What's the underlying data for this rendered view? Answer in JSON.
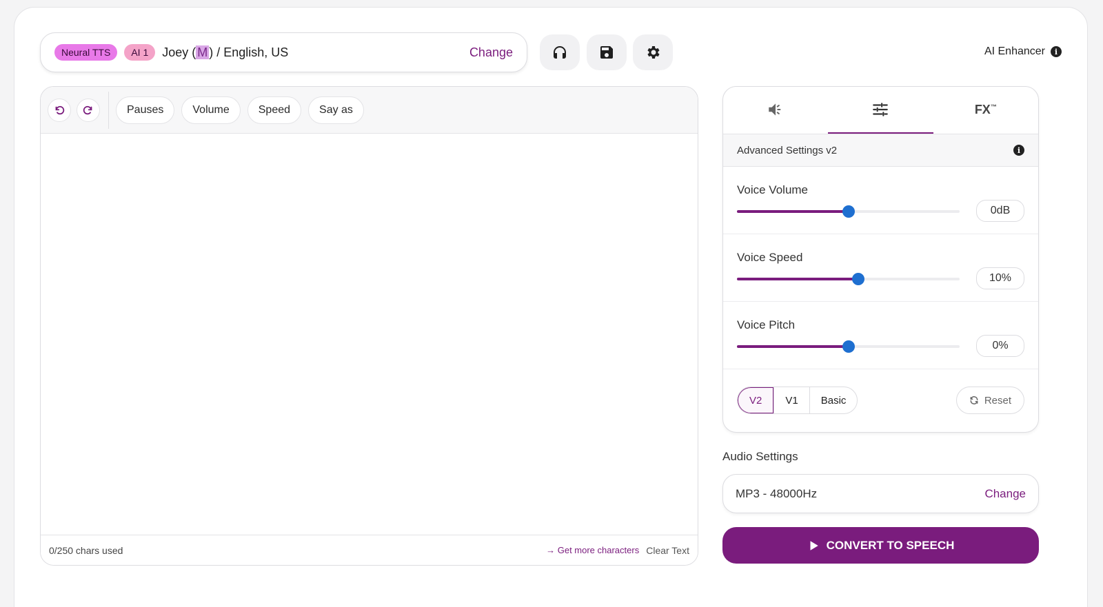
{
  "voice": {
    "badge_neural": "Neural TTS",
    "badge_ai": "AI 1",
    "name_prefix": "Joey (",
    "gender": "M",
    "name_suffix": ") / English, US",
    "change_label": "Change"
  },
  "header": {
    "ai_enhancer_label": "AI Enhancer",
    "info_glyph": "i"
  },
  "toolbar": {
    "chips": [
      "Pauses",
      "Volume",
      "Speed",
      "Say as"
    ]
  },
  "editor": {
    "chars_used": "0/250 chars used",
    "more_chars": "→ Get more characters",
    "clear_text": "Clear Text"
  },
  "settings": {
    "fx_tab": "FX",
    "fx_tm": "™",
    "advanced_title": "Advanced Settings v2",
    "sliders": [
      {
        "label": "Voice Volume",
        "value": "0dB",
        "fraction": 0.5
      },
      {
        "label": "Voice Speed",
        "value": "10%",
        "fraction": 0.545
      },
      {
        "label": "Voice Pitch",
        "value": "0%",
        "fraction": 0.5
      }
    ],
    "versions": [
      "V2",
      "V1",
      "Basic"
    ],
    "active_version": "V2",
    "reset_label": "Reset"
  },
  "audio": {
    "title": "Audio Settings",
    "format": "MP3 - 48000Hz",
    "change_label": "Change"
  },
  "convert": {
    "label": "CONVERT TO SPEECH"
  },
  "colors": {
    "accent": "#7a1c7d",
    "slider_thumb": "#1e6fd0"
  }
}
